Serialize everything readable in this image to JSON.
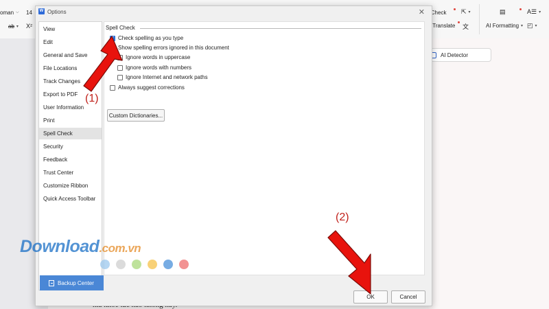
{
  "app_toolbar": {
    "font_name_fragment": "oman",
    "font_size": "14",
    "strike_label": "ab",
    "superscript_label": "X²",
    "spell_check_label": "ll Check",
    "translate_label": "el Translate",
    "ai_formatting_label": "AI Formatting",
    "ai_detector_label": "AI Detector"
  },
  "document": {
    "text_fragment": "nia khoe tuc nao khong nay."
  },
  "dialog": {
    "title": "Options",
    "close_glyph": "✕",
    "nav": [
      {
        "label": "View"
      },
      {
        "label": "Edit"
      },
      {
        "label": "General and Save"
      },
      {
        "label": "File Locations"
      },
      {
        "label": "Track Changes"
      },
      {
        "label": "Export to PDF"
      },
      {
        "label": "User Information"
      },
      {
        "label": "Print"
      },
      {
        "label": "Spell Check",
        "selected": true
      },
      {
        "label": "Security"
      },
      {
        "label": "Feedback"
      },
      {
        "label": "Trust Center"
      },
      {
        "label": "Customize Ribbon"
      },
      {
        "label": "Quick Access Toolbar"
      }
    ],
    "backup_center_label": "Backup Center",
    "section_title": "Spell Check",
    "options": [
      {
        "label": "Check spelling as you type",
        "checked": true
      },
      {
        "label": "Show spelling errors ignored in this document",
        "checked": false
      },
      {
        "label": "Ignore words in uppercase",
        "checked": false
      },
      {
        "label": "Ignore words with numbers",
        "checked": false
      },
      {
        "label": "Ignore Internet and network paths",
        "checked": false
      },
      {
        "label": "Always suggest corrections",
        "checked": false
      }
    ],
    "custom_dictionaries_label": "Custom Dictionaries...",
    "ok_label": "OK",
    "cancel_label": "Cancel"
  },
  "annotations": {
    "label_1": "(1)",
    "label_2": "(2)",
    "arrow_color": "#e8130d"
  },
  "watermark": {
    "brand": "Download",
    "domain": ".com.vn",
    "dot_colors": [
      "#9cc8ee",
      "#cfcfcf",
      "#a8d87a",
      "#f5c24a",
      "#4a90d9",
      "#ee6d6d"
    ]
  },
  "colors": {
    "accent_blue": "#2e6fd4",
    "backup_bar": "#4a87d6",
    "annotation_red": "#c0201a"
  }
}
